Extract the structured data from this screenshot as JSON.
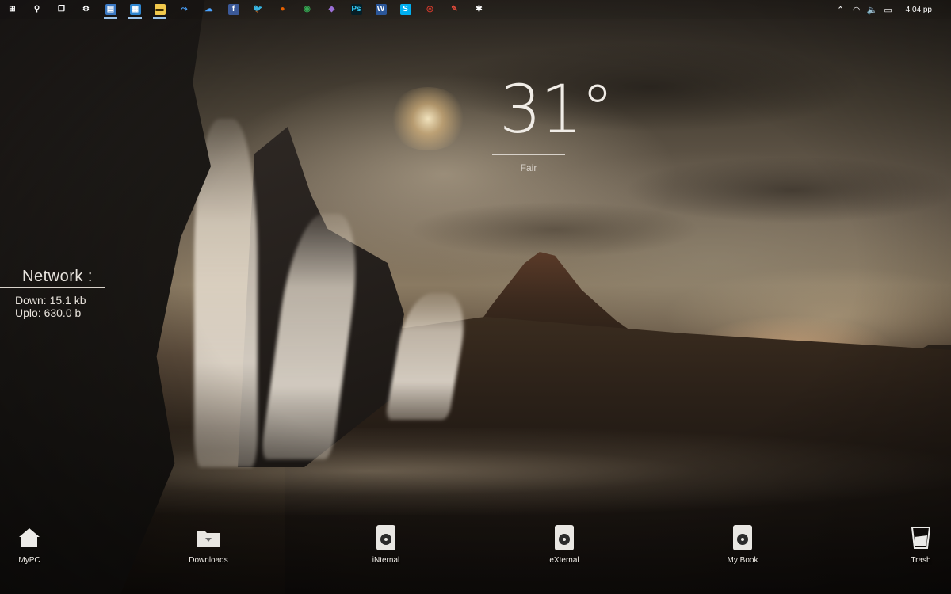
{
  "taskbar": {
    "pinned": [
      {
        "name": "start-windows-icon",
        "glyph": "⊞",
        "color": "#ffffff",
        "bg": "transparent"
      },
      {
        "name": "search-icon",
        "glyph": "⚲",
        "color": "#ffffff",
        "bg": "transparent"
      },
      {
        "name": "task-view-icon",
        "glyph": "❐",
        "color": "#ffffff",
        "bg": "transparent"
      },
      {
        "name": "settings-gear-icon",
        "glyph": "⚙",
        "color": "#ffffff",
        "bg": "transparent"
      },
      {
        "name": "file-manager-icon",
        "glyph": "▤",
        "color": "#ffffff",
        "bg": "#3a78c2"
      },
      {
        "name": "control-panel-icon",
        "glyph": "▦",
        "color": "#ffffff",
        "bg": "#2f86d0"
      },
      {
        "name": "file-explorer-folder-icon",
        "glyph": "▬",
        "color": "#3a2a00",
        "bg": "#f2c94c"
      },
      {
        "name": "app-icon",
        "glyph": "⤳",
        "color": "#4aa3ff",
        "bg": "transparent"
      },
      {
        "name": "onedrive-cloud-icon",
        "glyph": "☁",
        "color": "#4aa3ff",
        "bg": "transparent"
      },
      {
        "name": "facebook-icon",
        "glyph": "f",
        "color": "#ffffff",
        "bg": "#3b5998"
      },
      {
        "name": "twitter-icon",
        "glyph": "🐦",
        "color": "#1da1f2",
        "bg": "transparent"
      },
      {
        "name": "firefox-icon",
        "glyph": "●",
        "color": "#e66000",
        "bg": "transparent"
      },
      {
        "name": "chrome-icon",
        "glyph": "◉",
        "color": "#34a853",
        "bg": "transparent"
      },
      {
        "name": "visual-studio-icon",
        "glyph": "◆",
        "color": "#9b6fd6",
        "bg": "transparent"
      },
      {
        "name": "photoshop-icon",
        "glyph": "Ps",
        "color": "#31c5f0",
        "bg": "#061e26"
      },
      {
        "name": "word-icon",
        "glyph": "W",
        "color": "#ffffff",
        "bg": "#2b579a"
      },
      {
        "name": "skype-icon",
        "glyph": "S",
        "color": "#ffffff",
        "bg": "#00aff0"
      },
      {
        "name": "red-app-icon",
        "glyph": "◎",
        "color": "#d33a2c",
        "bg": "transparent"
      },
      {
        "name": "red-tool-icon",
        "glyph": "✎",
        "color": "#e04a3a",
        "bg": "transparent"
      },
      {
        "name": "bug-app-icon",
        "glyph": "✱",
        "color": "#ffffff",
        "bg": "transparent"
      }
    ],
    "tray": [
      {
        "name": "show-hidden-icons-chevron-icon",
        "glyph": "⌃"
      },
      {
        "name": "wifi-icon",
        "glyph": "◠"
      },
      {
        "name": "volume-icon",
        "glyph": "🔈"
      },
      {
        "name": "action-center-icon",
        "glyph": "▭"
      }
    ],
    "clock": "4:04 pp"
  },
  "weather": {
    "temperature": "31°",
    "condition": "Fair"
  },
  "network": {
    "title": "Network :",
    "down": "Down: 15.1 kb",
    "up": "Uplo: 630.0 b"
  },
  "desktop_icons": [
    {
      "label": "MyPC",
      "type": "house"
    },
    {
      "label": "Downloads",
      "type": "folder"
    },
    {
      "label": "iNternal",
      "type": "drive"
    },
    {
      "label": "eXternal",
      "type": "drive"
    },
    {
      "label": "My Book",
      "type": "drive"
    },
    {
      "label": "Trash",
      "type": "trash"
    }
  ],
  "colors": {
    "active_indicator": "#9cc3e8",
    "widget_text": "#f0ece6"
  }
}
